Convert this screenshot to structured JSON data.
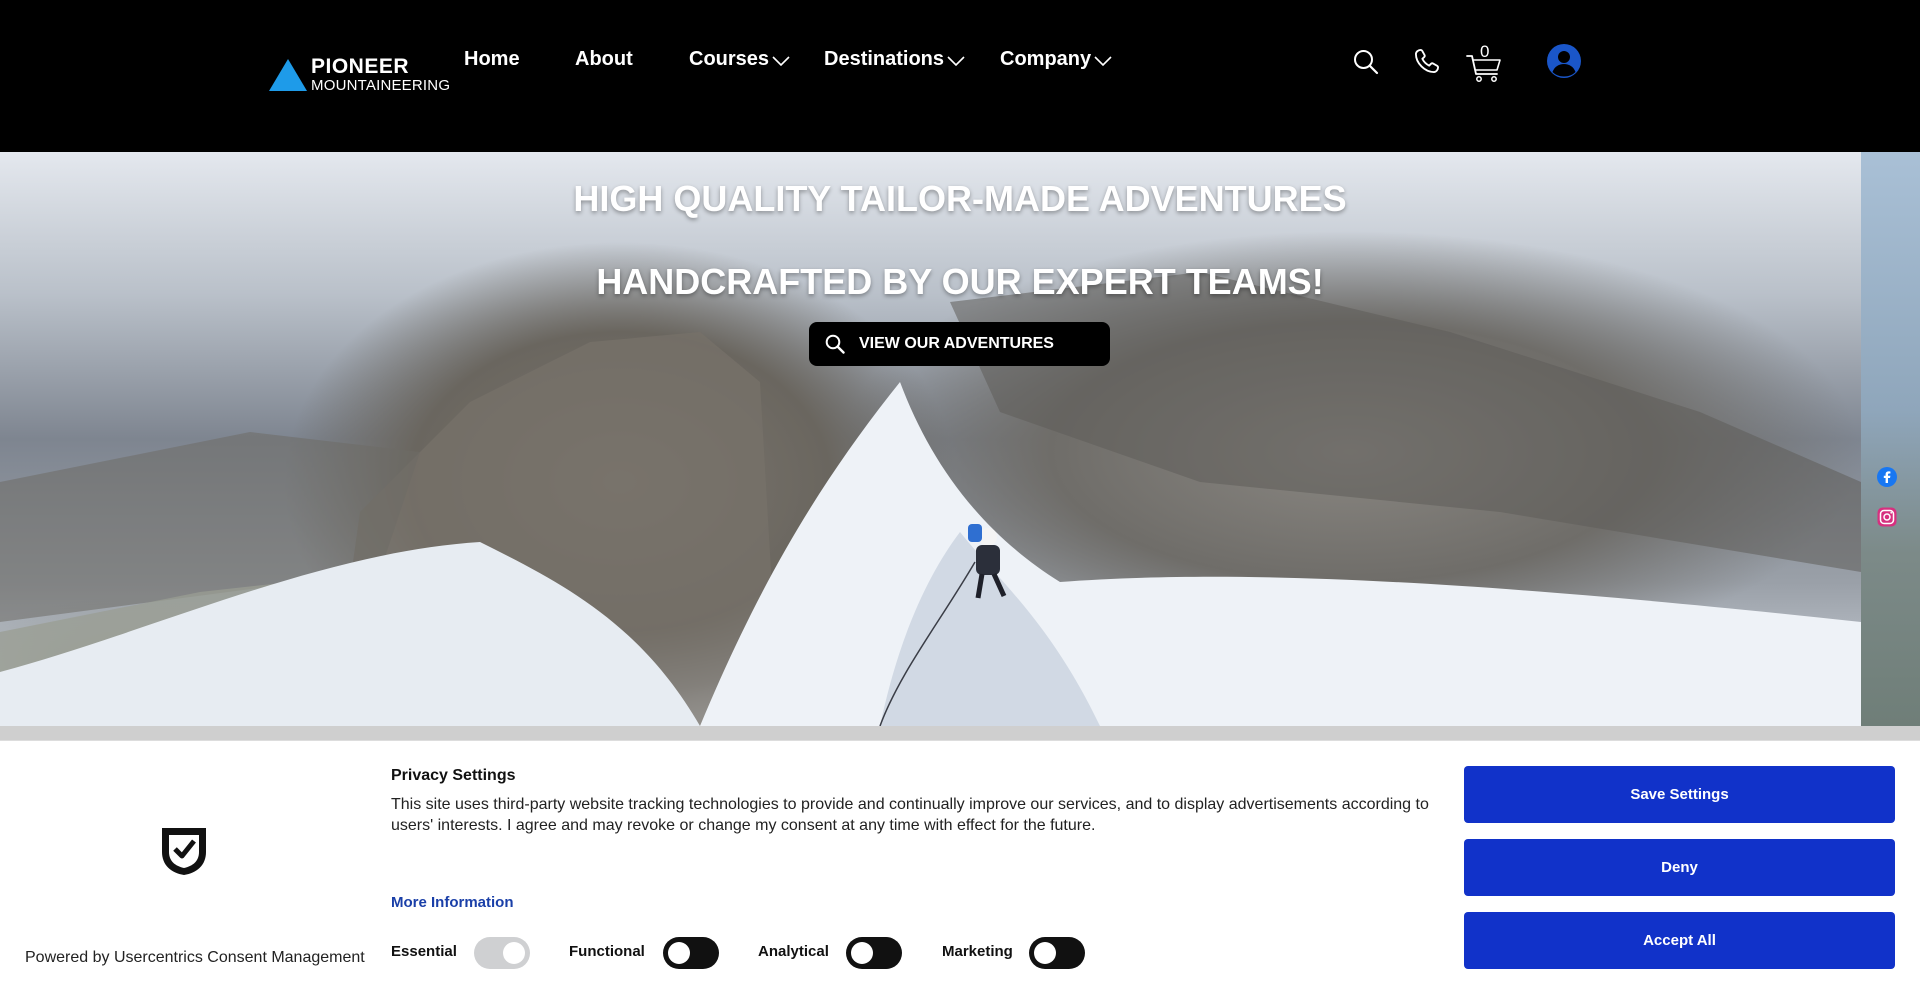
{
  "header": {
    "logo": {
      "line1": "PIONEER",
      "line2": "MOUNTAINEERING",
      "triangle_color": "#1e9be9"
    },
    "nav": [
      {
        "label": "Home",
        "has_dropdown": false
      },
      {
        "label": "About",
        "has_dropdown": false
      },
      {
        "label": "Courses",
        "has_dropdown": true
      },
      {
        "label": "Destinations",
        "has_dropdown": true
      },
      {
        "label": "Company",
        "has_dropdown": true
      }
    ],
    "icons": [
      "search-icon",
      "phone-icon",
      "cart-icon",
      "account-icon"
    ],
    "cart_count": "0",
    "account_color": "#1a56c9"
  },
  "hero": {
    "title_line1": "HIGH QUALITY TAILOR-MADE ADVENTURES",
    "title_line2": "HANDCRAFTED BY OUR EXPERT TEAMS!",
    "cta_label": "VIEW OUR ADVENTURES",
    "social": [
      "facebook-icon",
      "instagram-icon"
    ]
  },
  "consent": {
    "title": "Privacy Settings",
    "text": "This site uses third-party website tracking technologies to provide and continually improve our services, and to display advertisements according to users' interests. I agree and may revoke or change my consent at any time with effect for the future.",
    "more_info": "More Information",
    "powered_by": "Powered by Usercentrics Consent Management",
    "toggles": [
      {
        "label": "Essential",
        "on": true,
        "disabled": true
      },
      {
        "label": "Functional",
        "on": false
      },
      {
        "label": "Analytical",
        "on": false
      },
      {
        "label": "Marketing",
        "on": false
      }
    ],
    "buttons": {
      "save": "Save Settings",
      "deny": "Deny",
      "accept": "Accept All"
    },
    "button_color": "#1132c9"
  }
}
